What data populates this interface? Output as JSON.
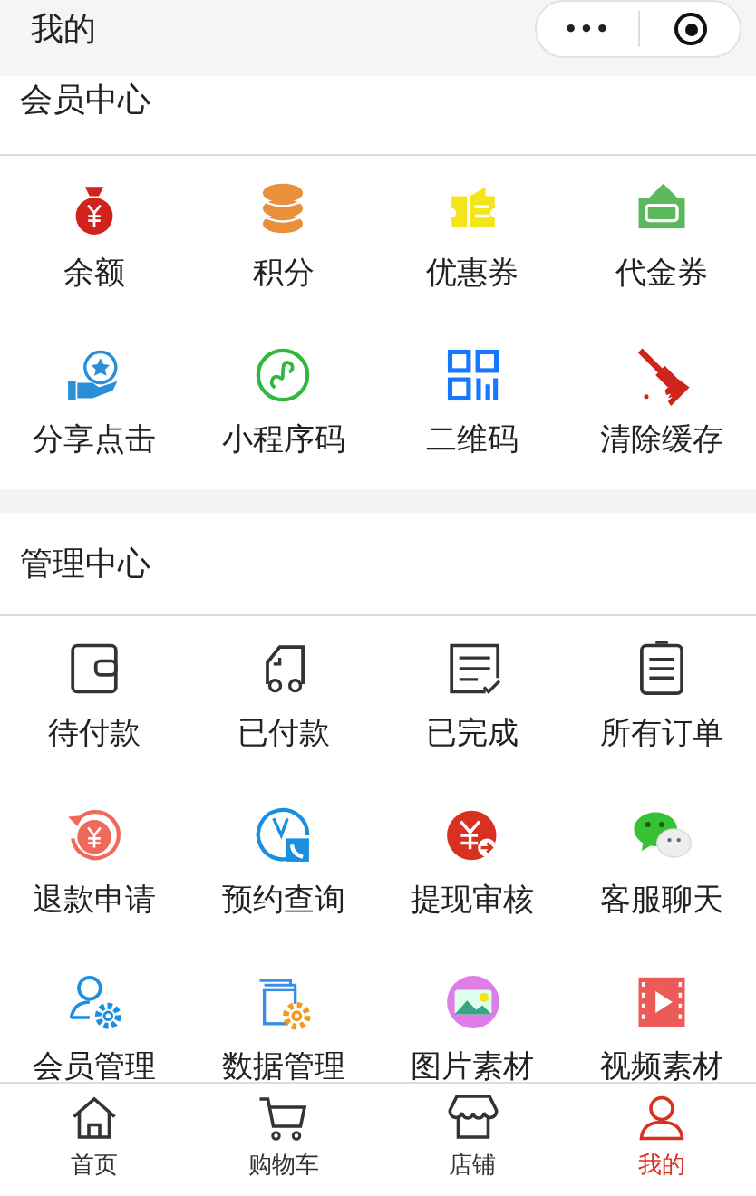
{
  "header": {
    "title": "我的",
    "menu_button": "•••"
  },
  "sections": [
    {
      "title": "会员中心",
      "items": [
        {
          "label": "余额"
        },
        {
          "label": "积分"
        },
        {
          "label": "优惠券"
        },
        {
          "label": "代金券"
        },
        {
          "label": "分享点击"
        },
        {
          "label": "小程序码"
        },
        {
          "label": "二维码"
        },
        {
          "label": "清除缓存"
        }
      ]
    },
    {
      "title": "管理中心",
      "items": [
        {
          "label": "待付款"
        },
        {
          "label": "已付款"
        },
        {
          "label": "已完成"
        },
        {
          "label": "所有订单"
        },
        {
          "label": "退款申请"
        },
        {
          "label": "预约查询"
        },
        {
          "label": "提现审核"
        },
        {
          "label": "客服聊天"
        },
        {
          "label": "会员管理"
        },
        {
          "label": "数据管理"
        },
        {
          "label": "图片素材"
        },
        {
          "label": "视频素材"
        }
      ]
    }
  ],
  "tabs": [
    {
      "label": "首页",
      "selected": false
    },
    {
      "label": "购物车",
      "selected": false
    },
    {
      "label": "店铺",
      "selected": false
    },
    {
      "label": "我的",
      "selected": true
    }
  ]
}
